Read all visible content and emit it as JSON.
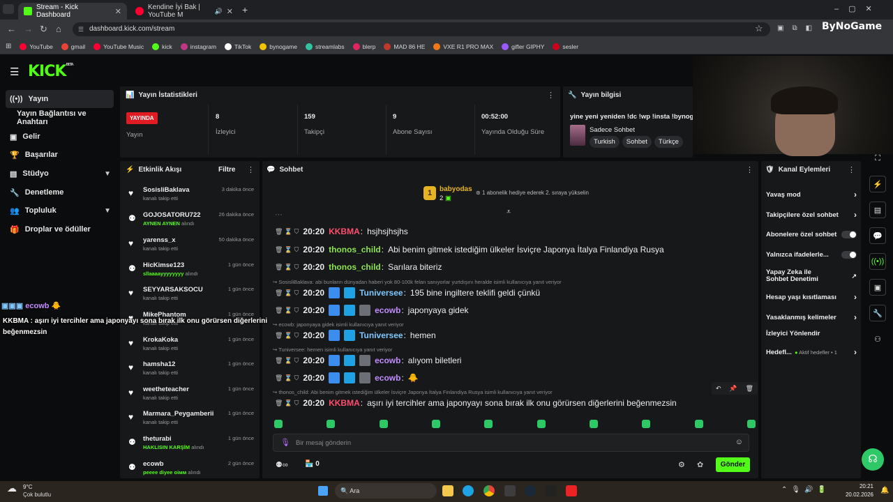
{
  "browser": {
    "tabs": [
      {
        "title": "Stream - Kick Dashboard",
        "color": "#53fc18"
      },
      {
        "title": "Kendine İyi Bak | YouTube M",
        "color": "#ff0033"
      }
    ],
    "url": "dashboard.kick.com/stream",
    "profile": "ByNoGame",
    "bookmarks": [
      {
        "label": "YouTube",
        "color": "#ff0033"
      },
      {
        "label": "gmail",
        "color": "#ea4335"
      },
      {
        "label": "YouTube Music",
        "color": "#ff0033"
      },
      {
        "label": "kick",
        "color": "#53fc18"
      },
      {
        "label": "instagram",
        "color": "#c13584"
      },
      {
        "label": "TikTok",
        "color": "#ffffff"
      },
      {
        "label": "bynogame",
        "color": "#f5c400"
      },
      {
        "label": "streamlabs",
        "color": "#31c3a2"
      },
      {
        "label": "blerp",
        "color": "#e0245e"
      },
      {
        "label": "MAD 86 HE",
        "color": "#c0392b"
      },
      {
        "label": "VXE R1 PRO MAX",
        "color": "#f07818"
      },
      {
        "label": "gifler GIPHY",
        "color": "#9b59ff"
      },
      {
        "label": "sesler",
        "color": "#d0021b"
      }
    ]
  },
  "app": {
    "logo": "KICK",
    "logo_sup": "BETA"
  },
  "sidebar": {
    "items": [
      {
        "label": "Yayın",
        "icon": "broadcast-icon"
      },
      {
        "label": "Yayın Bağlantısı ve Anahtarı"
      },
      {
        "label": "Gelir",
        "icon": "wallet-icon"
      },
      {
        "label": "Başarılar",
        "icon": "trophy-icon"
      },
      {
        "label": "Stüdyo",
        "icon": "studio-icon"
      },
      {
        "label": "Denetleme",
        "icon": "wrench-icon"
      },
      {
        "label": "Topluluk",
        "icon": "people-icon"
      },
      {
        "label": "Droplar ve ödüller",
        "icon": "gift-icon"
      }
    ]
  },
  "stats": {
    "title": "Yayın İstatistikleri",
    "live_badge": "YAYINDA",
    "live_label": "Yayın",
    "items": [
      {
        "value": "8",
        "label": "İzleyici"
      },
      {
        "value": "159",
        "label": "Takipçi"
      },
      {
        "value": "9",
        "label": "Abone Sayısı"
      },
      {
        "value": "00:52:00",
        "label": "Yayında Olduğu Süre"
      }
    ]
  },
  "stream_info": {
    "title": "Yayın bilgisi",
    "stream_title": "yine yeni yeniden !dc !wp !insta !bynog",
    "category": "Sadece Sohbet",
    "tags": [
      "Turkish",
      "Sohbet",
      "Türkçe"
    ]
  },
  "activity": {
    "title": "Etkinlik Akışı",
    "filter": "Filtre",
    "items": [
      {
        "name": "SosisliBaklava",
        "sub": "kanalı takip etti",
        "time": "3 dakika önce",
        "icon": "heart-icon",
        "gift": false
      },
      {
        "name": "GOJOSATORU722",
        "sub": "AYNEN AYNEN",
        "suffix": "alındı",
        "time": "26 dakika önce",
        "icon": "points-icon",
        "gift": true
      },
      {
        "name": "yarenss_x",
        "sub": "kanalı takip etti",
        "time": "50 dakika önce",
        "icon": "heart-icon",
        "gift": false
      },
      {
        "name": "HicKimse123",
        "sub": "sllaaaayyyyyyyy",
        "suffix": "alındı",
        "time": "1 gün önce",
        "icon": "points-icon",
        "gift": true
      },
      {
        "name": "SEYYARSAKSOCU",
        "sub": "kanalı takip etti",
        "time": "1 gün önce",
        "icon": "heart-icon",
        "gift": false
      },
      {
        "name": "MikePhantom",
        "sub": "kanalı takip etti",
        "time": "1 gün önce",
        "icon": "heart-icon",
        "gift": false
      },
      {
        "name": "KrokaKoka",
        "sub": "kanalı takip etti",
        "time": "1 gün önce",
        "icon": "heart-icon",
        "gift": false
      },
      {
        "name": "hamsha12",
        "sub": "kanalı takip etti",
        "time": "1 gün önce",
        "icon": "heart-icon",
        "gift": false
      },
      {
        "name": "weetheteacher",
        "sub": "kanalı takip etti",
        "time": "1 gün önce",
        "icon": "heart-icon",
        "gift": false
      },
      {
        "name": "Marmara_Peygamberii",
        "sub": "kanalı takip etti",
        "time": "1 gün önce",
        "icon": "heart-icon",
        "gift": false
      },
      {
        "name": "theturabi",
        "sub": "HAKLISIN KARŞİM",
        "suffix": "alındı",
        "time": "1 gün önce",
        "icon": "points-icon",
        "gift": true
      },
      {
        "name": "ecowb",
        "sub": "рееее dіуее оімм",
        "suffix": "alındı",
        "time": "2 gün önce",
        "icon": "points-icon",
        "gift": true
      }
    ]
  },
  "chat": {
    "title": "Sohbet",
    "pinned_user": "babyodas",
    "pinned_count": "2",
    "pinned_text": "1 abonelik hediye ederek 2. sıraya yükselin",
    "messages": [
      {
        "time": "20:20",
        "user": "KKBMA",
        "color": "#ff4d6d",
        "text": "hsjhsjhsjhs",
        "badges": 0
      },
      {
        "time": "20:20",
        "user": "thonos_child",
        "color": "#8ee34f",
        "text": "Abi benim gitmek istediğim ülkeler İsviçre Japonya İtalya Finlandiya Rusya",
        "badges": 0
      },
      {
        "time": "20:20",
        "user": "thonos_child",
        "color": "#8ee34f",
        "text": "Sarılara biteriz",
        "badges": 0
      },
      {
        "reply": "SosisliBaklava: abi bunların dünyadan haberi yok 80-100k felan sanıyorlar yurtdışını heralde isimli kullanıcıya yanıt veriyor",
        "time": "20:20",
        "user": "Tuniversee",
        "color": "#7ec8ff",
        "text": "195 bine ingiltere teklifi geldi çünkü",
        "badges": 2
      },
      {
        "time": "20:20",
        "user": "ecowb",
        "color": "#c28cff",
        "text": "japonyaya gidek",
        "badges": 3
      },
      {
        "reply": "ecowb: japonyaya gidek isimli kullanıcıya yanıt veriyor",
        "time": "20:20",
        "user": "Tuniversee",
        "color": "#7ec8ff",
        "text": "hemen",
        "badges": 2
      },
      {
        "reply": "Tuniversee: hemen isimli kullanıcıya yanıt veriyor",
        "time": "20:20",
        "user": "ecowb",
        "color": "#c28cff",
        "text": "alıyom biletleri",
        "badges": 3
      },
      {
        "time": "20:20",
        "user": "ecowb",
        "color": "#c28cff",
        "text": "🐥",
        "badges": 3
      },
      {
        "reply": "thonos_child: Abi benim gitmek istediğim ülkeler İsviçre Japonya İtalya Finlandiya Rusya isimli kullanıcıya yanıt veriyor",
        "time": "20:20",
        "user": "KKBMA",
        "color": "#ff4d6d",
        "text": "aşırı iyi tercihler ama japonyayı sona bırak ilk onu görürsen diğerlerini beğenmezsin",
        "badges": 0
      }
    ],
    "input_placeholder": "Bir mesaj gönderin",
    "points": "0",
    "send_label": "Gönder"
  },
  "overlay": {
    "user": "ecowb",
    "emoji": "🐥",
    "line1": "KKBMA : aşırı iyi tercihler ama japonyayı sona bırak ilk onu görürsen diğerlerini",
    "line2": "beğenmezsin"
  },
  "actions": {
    "title": "Kanal Eylemleri",
    "items": [
      {
        "label": "Yavaş mod",
        "control": "chevron"
      },
      {
        "label": "Takipçilere özel sohbet",
        "control": "chevron"
      },
      {
        "label": "Abonelere özel sohbet",
        "control": "toggle"
      },
      {
        "label": "Yalnızca ifadelerle...",
        "control": "toggle"
      },
      {
        "label": "Yapay Zeka ile Sohbet Denetimi",
        "control": "external"
      },
      {
        "label": "Hesap yaşı kısıtlaması",
        "control": "chevron"
      },
      {
        "label": "Yasaklanmış kelimeler",
        "control": "chevron"
      },
      {
        "label": "İzleyici Yönlendir",
        "control": "none"
      },
      {
        "label": "Hedefl...",
        "extra": "Aktif hedefler • 1",
        "control": "chevron"
      }
    ]
  },
  "taskbar": {
    "weather_temp": "9°C",
    "weather_desc": "Çok bulutlu",
    "search": "Ara",
    "time": "20:21",
    "date": "20.02.2026"
  }
}
